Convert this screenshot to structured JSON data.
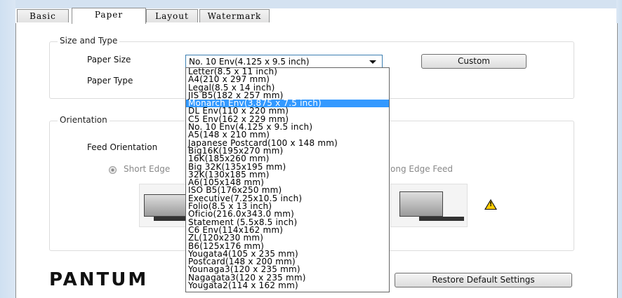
{
  "tabs": [
    {
      "label": "Basic",
      "active": false
    },
    {
      "label": "Paper",
      "active": true
    },
    {
      "label": "Layout",
      "active": false
    },
    {
      "label": "Watermark",
      "active": false
    }
  ],
  "size_and_type": {
    "title": "Size and Type",
    "paper_size_label": "Paper Size",
    "paper_type_label": "Paper Type",
    "paper_size_value": "No. 10 Env(4.125 x 9.5 inch)",
    "custom_button": "Custom"
  },
  "paper_size_options": [
    "Letter(8.5 x 11 inch)",
    "A4(210 x 297 mm)",
    "Legal(8.5 x 14 inch)",
    "JIS B5(182 x 257 mm)",
    "Monarch Env(3.875 x 7.5 inch)",
    "DL Env(110 x 220 mm)",
    "C5 Env(162 x 229 mm)",
    "No. 10 Env(4.125 x 9.5 inch)",
    "A5(148 x 210 mm)",
    "Japanese Postcard(100 x 148 mm)",
    "Big16K(195x270 mm)",
    "16K(185x260 mm)",
    "Big 32K(135x195 mm)",
    "32K(130x185 mm)",
    "A6(105x148 mm)",
    "ISO B5(176x250 mm)",
    "Executive(7.25x10.5 inch)",
    "Folio(8.5 x 13 inch)",
    "Oficio(216.0x343.0 mm)",
    "Statement (5.5x8.5 inch)",
    "C6 Env(114x162 mm)",
    "ZL(120x230 mm)",
    "B6(125x176 mm)",
    "Yougata4(105 x 235 mm)",
    "Postcard(148 x 200 mm)",
    "Younaga3(120 x 235 mm)",
    "Nagagata3(120 x 235 mm)",
    "Yougata2(114 x 162 mm)"
  ],
  "highlighted_option_index": 4,
  "orientation": {
    "title": "Orientation",
    "feed_orientation_label": "Feed Orientation",
    "short_edge_label": "Short Edge",
    "long_edge_label": "ong Edge Feed"
  },
  "footer": {
    "logo_text": "PANTUM",
    "restore_button": "Restore Default Settings"
  },
  "colors": {
    "highlight": "#3399ff",
    "frame": "#d4e2f1",
    "warning": "#ffcc00"
  }
}
